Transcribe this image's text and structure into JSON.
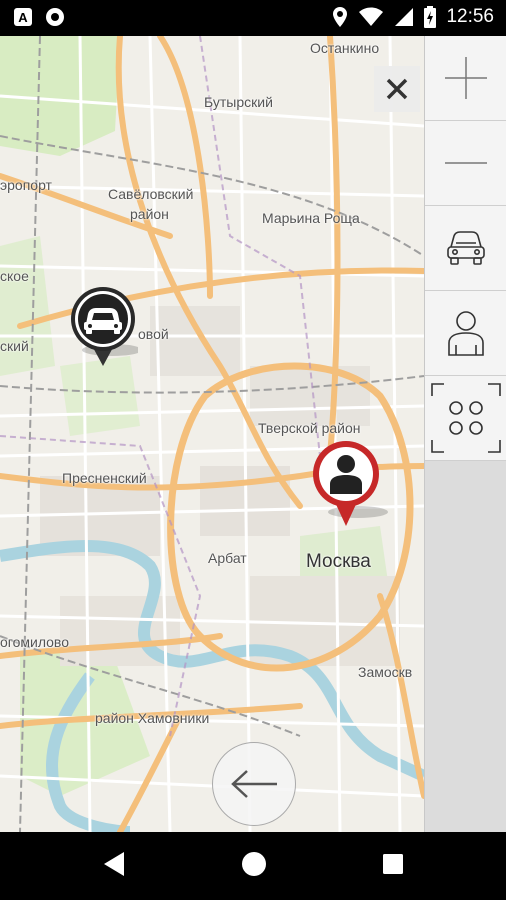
{
  "status_bar": {
    "time": "12:56",
    "left_icons": [
      "a-app-icon",
      "record-icon"
    ],
    "right_icons": [
      "location-icon",
      "wifi-icon",
      "signal-icon",
      "battery-icon"
    ],
    "app_icon_letter": "A"
  },
  "map": {
    "labels": {
      "ostankino": "Останкино",
      "butyrsky": "Бутырский",
      "aeroport": "эропорт",
      "savelovsky_1": "Савёловский",
      "savelovsky_2": "район",
      "maryina_roshcha": "Марьина Роща",
      "sokol_fragment": "ское",
      "khoroshevo_fragment": "ский",
      "begovoy_fragment": "овой",
      "tverskoy": "Тверской район",
      "presnensky": "Пресненский",
      "arbat": "Арбат",
      "moskva": "Москва",
      "dorogomilovo": "огомилово",
      "zamoskvorechye": "Замоскв",
      "khamovniki": "район Хамовники"
    },
    "markers": [
      {
        "type": "car",
        "icon": "car-icon",
        "color": "#1a1a1a"
      },
      {
        "type": "person",
        "icon": "person-icon",
        "color": "#c62828"
      }
    ]
  },
  "controls": {
    "close_icon": "close-icon",
    "back_icon": "arrow-left-icon",
    "sidebar": [
      "zoom-in-icon",
      "zoom-out-icon",
      "car-icon",
      "person-icon",
      "fit-bounds-icon"
    ]
  },
  "nav_bar": [
    "back-triangle-icon",
    "home-circle-icon",
    "recents-square-icon"
  ],
  "colors": {
    "map_bg": "#f1efe9",
    "road_major": "#f7c98e",
    "road_minor": "#ffffff",
    "water": "#aad3df",
    "park": "#cdebb0",
    "marker_red": "#c62828"
  }
}
